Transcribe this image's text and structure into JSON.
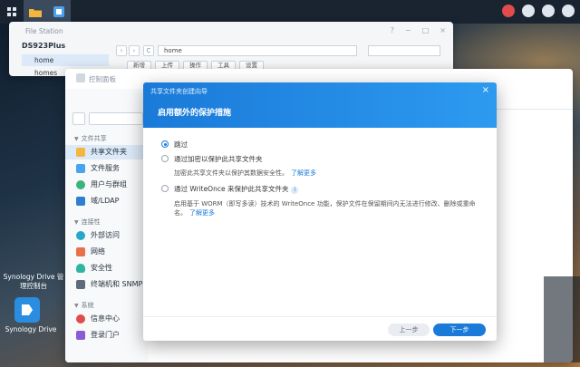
{
  "file_station": {
    "title": "File Station",
    "window_controls": [
      "?",
      "−",
      "□",
      "×"
    ],
    "host": "DS923Plus",
    "folders": [
      "home",
      "homes"
    ],
    "path": "home",
    "nav_refresh": "C",
    "toolbar_buttons": [
      "新增",
      "上传",
      "操作",
      "工具",
      "设置"
    ]
  },
  "control_panel": {
    "title": "控制面板",
    "sections": [
      {
        "label": "文件共享",
        "items": [
          "共享文件夹",
          "文件服务",
          "用户与群组",
          "域/LDAP"
        ]
      },
      {
        "label": "连接性",
        "items": [
          "外部访问",
          "网络",
          "安全性",
          "终端机和 SNMP"
        ]
      },
      {
        "label": "系统",
        "items": [
          "信息中心",
          "登录门户"
        ]
      }
    ]
  },
  "desktop": {
    "drive_label_top": "Synology Drive 管理控制台",
    "drive_label": "Synology Drive"
  },
  "wizard": {
    "caption": "共享文件夹创建向导",
    "heading": "启用额外的保护措施",
    "close": "×",
    "options": [
      {
        "label": "跳过",
        "selected": true
      },
      {
        "label": "通过加密以保护此共享文件夹",
        "selected": false,
        "desc": "加密此共享文件夹以保护其数据安全性。",
        "link": "了解更多"
      },
      {
        "label": "通过 WriteOnce 来保护此共享文件夹",
        "selected": false,
        "desc": "启用基于 WORM（即写多读）技术的 WriteOnce 功能，保护文件在保留期间内无法进行修改、删除或重命名。",
        "link": "了解更多"
      }
    ],
    "info_icon": "i",
    "btn_prev": "上一步",
    "btn_next": "下一步"
  },
  "colors": {
    "accent": "#1a7ad8",
    "selected_bg": "#dbe9f8"
  },
  "icons": [
    "apps-grid-icon",
    "folder-icon",
    "control-panel-icon",
    "notification-icon",
    "user-icon",
    "search-icon",
    "home-icon",
    "info-icon",
    "close-icon"
  ]
}
